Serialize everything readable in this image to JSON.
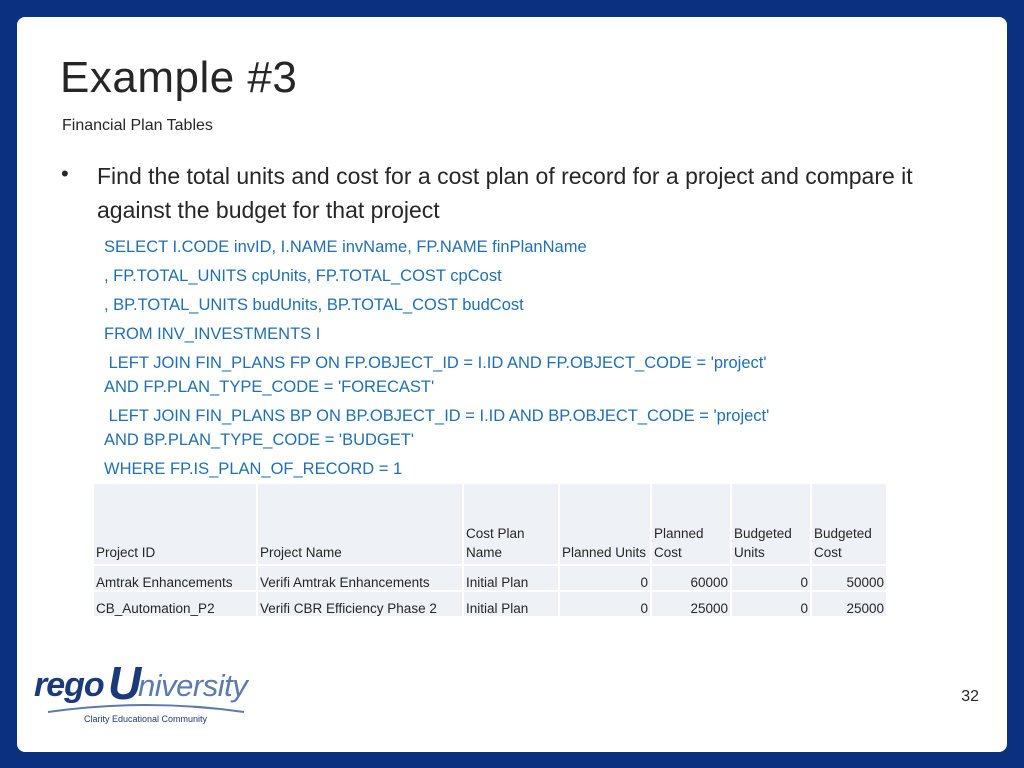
{
  "slide": {
    "title": "Example #3",
    "subtitle": "Financial Plan Tables",
    "bullet_symbol": "•",
    "bullet_text": "Find the total units and cost for a cost plan of record for a project and compare it against the budget for that project",
    "sql_lines": [
      "SELECT I.CODE invID, I.NAME invName, FP.NAME finPlanName",
      ", FP.TOTAL_UNITS cpUnits, FP.TOTAL_COST cpCost",
      ", BP.TOTAL_UNITS budUnits, BP.TOTAL_COST budCost",
      "FROM INV_INVESTMENTS I",
      " LEFT JOIN FIN_PLANS FP ON FP.OBJECT_ID = I.ID AND FP.OBJECT_CODE = 'project'",
      "AND FP.PLAN_TYPE_CODE = 'FORECAST'",
      " LEFT JOIN FIN_PLANS BP ON BP.OBJECT_ID = I.ID AND BP.OBJECT_CODE = 'project'",
      "AND BP.PLAN_TYPE_CODE = 'BUDGET'",
      "WHERE FP.IS_PLAN_OF_RECORD = 1"
    ],
    "table": {
      "headers": [
        [
          "Project ID"
        ],
        [
          "Project Name"
        ],
        [
          "Cost Plan",
          "Name"
        ],
        [
          "Planned Units"
        ],
        [
          "Planned",
          "Cost"
        ],
        [
          "Budgeted",
          "Units"
        ],
        [
          "Budgeted",
          "Cost"
        ]
      ],
      "rows": [
        [
          "Amtrak Enhancements",
          "Verifi Amtrak Enhancements",
          "Initial Plan",
          "0",
          "60000",
          "0",
          "50000"
        ],
        [
          "CB_Automation_P2",
          "Verifi CBR Efficiency Phase 2",
          "Initial Plan",
          "0",
          "25000",
          "0",
          "25000"
        ]
      ]
    },
    "page_number": "32"
  },
  "logo": {
    "part_rego": "rego",
    "part_u": "U",
    "part_niversity": "niversity",
    "tagline": "Clarity Educational Community"
  },
  "colors": {
    "background": "#0b3080",
    "sql_text": "#1f6fb2",
    "table_cell": "#eef1f6",
    "logo_dark": "#1c3a7a",
    "logo_light": "#5a7bb0"
  }
}
